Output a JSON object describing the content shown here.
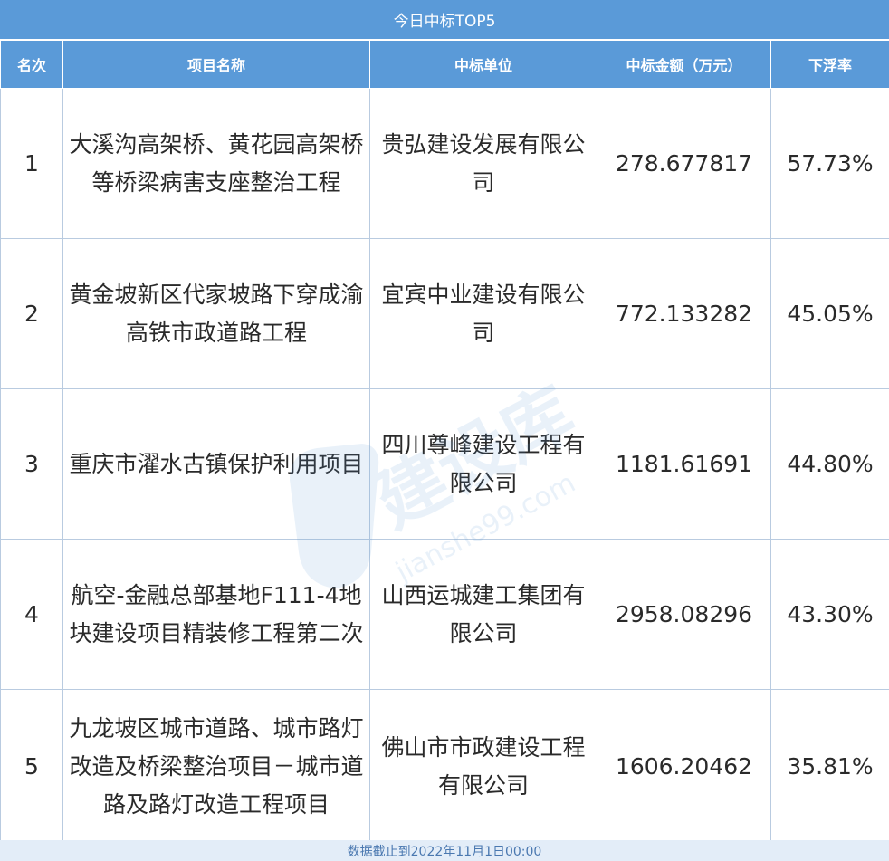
{
  "title": "今日中标TOP5",
  "headers": [
    "名次",
    "项目名称",
    "中标单位",
    "中标金额（万元）",
    "下浮率"
  ],
  "rows": [
    {
      "rank": "1",
      "project": "大溪沟高架桥、黄花园高架桥等桥梁病害支座整治工程",
      "company": "贵弘建设发展有限公司",
      "amount": "278.677817",
      "rate": "57.73%"
    },
    {
      "rank": "2",
      "project": "黄金坡新区代家坡路下穿成渝高铁市政道路工程",
      "company": "宜宾中业建设有限公司",
      "amount": "772.133282",
      "rate": "45.05%"
    },
    {
      "rank": "3",
      "project": "重庆市濯水古镇保护利用项目",
      "company": "四川尊峰建设工程有限公司",
      "amount": "1181.61691",
      "rate": "44.80%"
    },
    {
      "rank": "4",
      "project": "航空-金融总部基地F111-4地块建设项目精装修工程第二次",
      "company": "山西运城建工集团有限公司",
      "amount": "2958.08296",
      "rate": "43.30%"
    },
    {
      "rank": "5",
      "project": "九龙坡区城市道路、城市路灯改造及桥梁整治项目－城市道路及路灯改造工程项目",
      "company": "佛山市市政建设工程有限公司",
      "amount": "1606.20462",
      "rate": "35.81%"
    }
  ],
  "footer": "数据截止到2022年11月1日00:00",
  "watermark": {
    "cn": "建设库",
    "en": "jianshe99.com"
  },
  "colors": {
    "header_bg": "#5a9ad8",
    "border": "#b9cbe0",
    "footer_bg": "#e3edf8"
  }
}
